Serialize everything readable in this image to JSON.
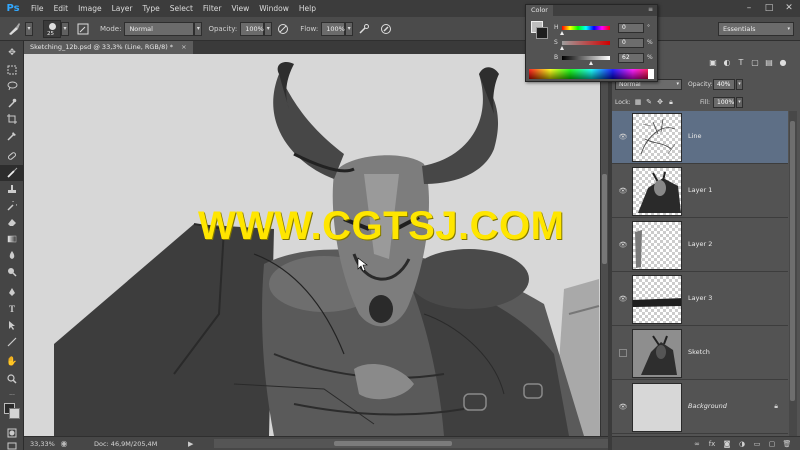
{
  "app": {
    "logo": "Ps",
    "menu": [
      "File",
      "Edit",
      "Image",
      "Layer",
      "Type",
      "Select",
      "Filter",
      "View",
      "Window",
      "Help"
    ],
    "window_controls": [
      "–",
      "□",
      "✕"
    ]
  },
  "options_bar": {
    "brush_size": "25",
    "mode_label": "Mode:",
    "mode_value": "Normal",
    "opacity_label": "Opacity:",
    "opacity_value": "100%",
    "flow_label": "Flow:",
    "flow_value": "100%",
    "workspace": "Essentials"
  },
  "document": {
    "tab_title": "Sketching_12b.psd @ 33,3% (Line, RGB/8) *",
    "close": "×",
    "watermark": "WWW.CGTSJ.COM"
  },
  "status_bar": {
    "zoom": "33,33%",
    "doc_size": "Doc: 46,9M/205,4M"
  },
  "color_panel": {
    "tab": "Color",
    "sliders": [
      {
        "name": "H",
        "value": "0",
        "unit": "°",
        "position": 0.0
      },
      {
        "name": "S",
        "value": "0",
        "unit": "%",
        "position": 0.0
      },
      {
        "name": "B",
        "value": "62",
        "unit": "%",
        "position": 0.62
      }
    ],
    "foreground_color": "#bdbdbd",
    "background_color": "#1e1e1e"
  },
  "layers_panel": {
    "blend_mode": "Normal",
    "opacity_label": "Opacity:",
    "opacity_value": "40%",
    "lock_label": "Lock:",
    "fill_label": "Fill:",
    "fill_value": "100%",
    "layers": [
      {
        "name": "Line",
        "selected": true,
        "visible": true,
        "thumb": "line"
      },
      {
        "name": "Layer 1",
        "selected": false,
        "visible": true,
        "thumb": "figure"
      },
      {
        "name": "Layer 2",
        "selected": false,
        "visible": true,
        "thumb": "bar"
      },
      {
        "name": "Layer 3",
        "selected": false,
        "visible": true,
        "thumb": "strip"
      },
      {
        "name": "Sketch",
        "selected": false,
        "visible": false,
        "thumb": "sketch"
      },
      {
        "name": "Background",
        "selected": false,
        "visible": true,
        "thumb": "plain",
        "locked": true
      }
    ]
  },
  "colors": {
    "selection": "#5e6f86",
    "watermark": "#ffe600",
    "ps_blue": "#31a8ff"
  }
}
